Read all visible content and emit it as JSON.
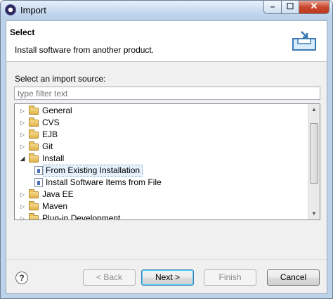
{
  "window": {
    "title": "Import",
    "minimize_icon": "minimize-icon",
    "maximize_icon": "maximize-icon",
    "close_icon": "close-icon"
  },
  "header": {
    "title": "Select",
    "description": "Install software from another product."
  },
  "filter": {
    "label": "Select an import source:",
    "placeholder": "type filter text",
    "value": ""
  },
  "tree": {
    "items": [
      {
        "label": "General",
        "expanded": false,
        "level": 0,
        "icon": "folder-icon"
      },
      {
        "label": "CVS",
        "expanded": false,
        "level": 0,
        "icon": "folder-icon"
      },
      {
        "label": "EJB",
        "expanded": false,
        "level": 0,
        "icon": "folder-icon"
      },
      {
        "label": "Git",
        "expanded": false,
        "level": 0,
        "icon": "folder-icon"
      },
      {
        "label": "Install",
        "expanded": true,
        "level": 0,
        "icon": "folder-icon"
      },
      {
        "label": "From Existing Installation",
        "level": 1,
        "icon": "wizard-icon",
        "selected": true
      },
      {
        "label": "Install Software Items from File",
        "level": 1,
        "icon": "wizard-icon"
      },
      {
        "label": "Java EE",
        "expanded": false,
        "level": 0,
        "icon": "folder-icon"
      },
      {
        "label": "Maven",
        "expanded": false,
        "level": 0,
        "icon": "folder-icon"
      },
      {
        "label": "Plug-in Development",
        "expanded": false,
        "level": 0,
        "icon": "folder-icon"
      }
    ]
  },
  "buttons": {
    "back": "< Back",
    "next": "Next >",
    "finish": "Finish",
    "cancel": "Cancel"
  },
  "colors": {
    "title_bar": "#c4d8ee",
    "close_button": "#c8482f",
    "selection": "#e5f0fb"
  }
}
